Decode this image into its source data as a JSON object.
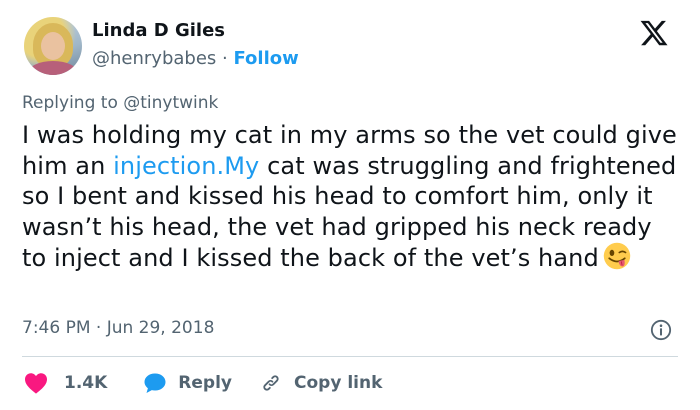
{
  "author": {
    "name": "Linda D Giles",
    "handle": "@henrybabes",
    "separator": "·",
    "follow_label": "Follow"
  },
  "reply_context": {
    "prefix": "Replying to",
    "mention": "@tinytwink"
  },
  "tweet": {
    "text_before_link": "I was holding my cat in my arms so the vet could give him an ",
    "link_text": "injection.My",
    "text_after_link": " cat was struggling and frightened so I bent and kissed his head to comfort him, only it wasn’t his head, the vet had gripped his neck ready to inject and I kissed the back of the vet’s hand",
    "emoji": "winking-face-with-tongue"
  },
  "meta": {
    "timestamp": "7:46 PM · Jun 29, 2018"
  },
  "actions": {
    "like_count": "1.4K",
    "reply_label": "Reply",
    "copy_link_label": "Copy link"
  },
  "colors": {
    "accent": "#1d9bf0",
    "like": "#f91880",
    "muted": "#536471",
    "text": "#0f1419"
  }
}
